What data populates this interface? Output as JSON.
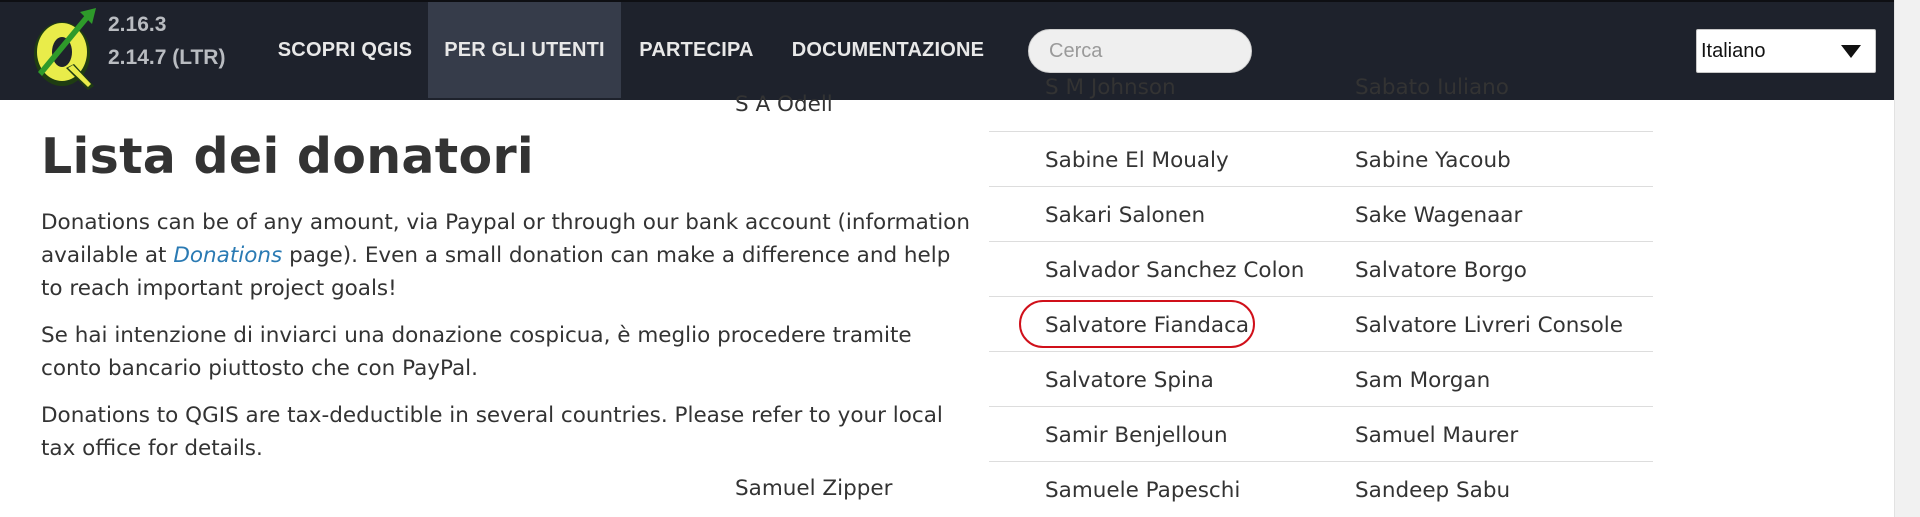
{
  "header": {
    "logo_letter": "Q",
    "version_current": "2.16.3",
    "version_ltr": "2.14.7 (LTR)",
    "nav": [
      {
        "label": "SCOPRI QGIS"
      },
      {
        "label": "PER GLI UTENTI",
        "active": true
      },
      {
        "label": "PARTECIPA"
      },
      {
        "label": "DOCUMENTAZIONE"
      }
    ],
    "search_placeholder": "Cerca",
    "language_selected": "Italiano"
  },
  "content": {
    "title": "Lista dei donatori",
    "para1_before": "Donations can be of any amount, via Paypal or through our bank account (information available at ",
    "para1_link": "Donations",
    "para1_after": " page). Even a small donation can make a difference and help to reach important project goals!",
    "para2": "Se hai intenzione di inviarci una donazione cospicua, è meglio procedere tramite conto bancario piuttosto che con PayPal.",
    "para3": "Donations to QGIS are tax-deductible in several countries. Please refer to your local tax office for details."
  },
  "donors": {
    "left_column_top": "S A Odell",
    "left_column_bottom": "Samuel Zipper",
    "rows": [
      [
        "S M Johnson",
        "Sabato Iuliano"
      ],
      [
        "Sabine El Moualy",
        "Sabine Yacoub"
      ],
      [
        "Sakari Salonen",
        "Sake Wagenaar"
      ],
      [
        "Salvador Sanchez Colon",
        "Salvatore Borgo"
      ],
      [
        "Salvatore Fiandaca",
        "Salvatore Livreri Console"
      ],
      [
        "Salvatore Spina",
        "Sam Morgan"
      ],
      [
        "Samir Benjelloun",
        "Samuel Maurer"
      ],
      [
        "Samuele Papeschi",
        "Sandeep Sabu"
      ]
    ],
    "highlighted_name": "Salvatore Fiandaca"
  },
  "colors": {
    "navbar": "#1e222c",
    "nav_active": "#363c4a",
    "logo_green": "#2e9a2a",
    "logo_yellow": "#e9ec4a",
    "link": "#2a7ab3",
    "highlight_ring": "#d0101a"
  }
}
